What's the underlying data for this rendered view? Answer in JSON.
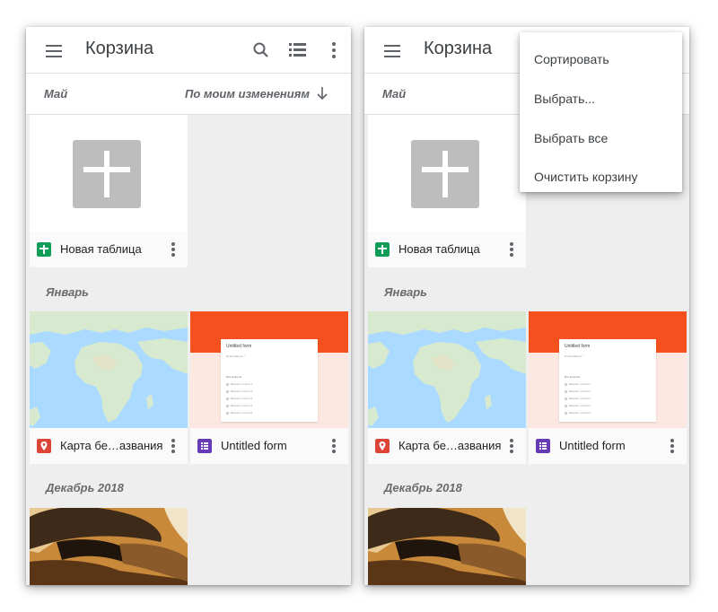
{
  "appbar": {
    "title": "Корзина",
    "icons": [
      "menu-icon",
      "search-icon",
      "list-view-icon",
      "more-vert-icon"
    ]
  },
  "sort_bar": {
    "month": "Май",
    "sort_label": "По моим изменениям",
    "sort_direction": "down-arrow-icon"
  },
  "sections": {
    "january": "Январь",
    "december": "Декабрь 2018"
  },
  "files": {
    "sheet": {
      "name": "Новая таблица",
      "type_icon": "sheets-icon",
      "color": "#0f9d58"
    },
    "map": {
      "name": "Карта бе…азвания",
      "type_icon": "my-maps-icon",
      "color": "#db4437"
    },
    "form": {
      "name": "Untitled form",
      "type_icon": "forms-icon",
      "color": "#673ab7",
      "preview": {
        "title": "Untitled form",
        "email": "Email address *",
        "question": "Без вопроса",
        "options": [
          "Вариант ответа 1",
          "Вариант ответа 2",
          "Вариант ответа 3",
          "Вариант ответа 4",
          "Вариант ответа 5"
        ]
      }
    }
  },
  "overflow_menu": {
    "items": [
      "Сортировать",
      "Выбрать...",
      "Выбрать все",
      "Очистить корзину"
    ]
  },
  "colors": {
    "background": "#eeeeee",
    "accent_form_header": "#f4511e",
    "map_water": "#aadaff",
    "map_land": "#d7ead0"
  }
}
